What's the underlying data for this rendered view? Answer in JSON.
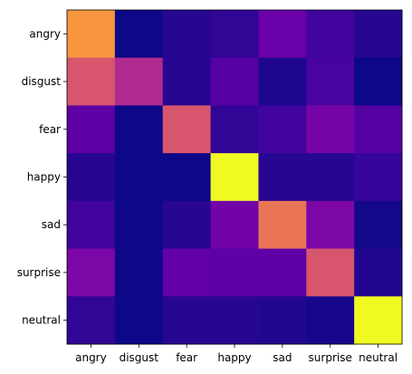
{
  "chart_data": {
    "type": "heatmap",
    "title": "",
    "xlabel": "",
    "ylabel": "",
    "colormap": "plasma",
    "x_categories": [
      "angry",
      "disgust",
      "fear",
      "happy",
      "sad",
      "surprise",
      "neutral"
    ],
    "y_categories": [
      "angry",
      "disgust",
      "fear",
      "happy",
      "sad",
      "surprise",
      "neutral"
    ],
    "value_range": [
      0,
      1
    ],
    "values": [
      [
        0.75,
        0.0,
        0.05,
        0.07,
        0.2,
        0.1,
        0.05
      ],
      [
        0.55,
        0.4,
        0.05,
        0.15,
        0.03,
        0.12,
        0.0
      ],
      [
        0.17,
        0.0,
        0.55,
        0.07,
        0.1,
        0.23,
        0.15
      ],
      [
        0.05,
        0.0,
        0.0,
        1.0,
        0.05,
        0.05,
        0.08
      ],
      [
        0.1,
        0.0,
        0.05,
        0.22,
        0.65,
        0.25,
        0.01
      ],
      [
        0.25,
        0.0,
        0.18,
        0.17,
        0.17,
        0.55,
        0.04
      ],
      [
        0.07,
        0.0,
        0.05,
        0.05,
        0.04,
        0.02,
        1.0
      ]
    ]
  }
}
